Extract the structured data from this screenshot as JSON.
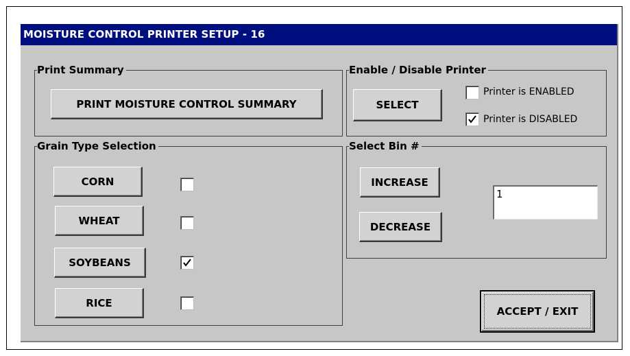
{
  "window": {
    "title": "MOISTURE CONTROL PRINTER SETUP - 16",
    "title_bar_color": "#000f80",
    "background_color": "#c7c7c7"
  },
  "print_summary": {
    "legend": "Print Summary",
    "button_label": "PRINT MOISTURE CONTROL SUMMARY"
  },
  "printer": {
    "legend": "Enable / Disable Printer",
    "select_label": "SELECT",
    "enabled_label": "Printer is ENABLED",
    "enabled_checked": false,
    "disabled_label": "Printer is DISABLED",
    "disabled_checked": true
  },
  "grain": {
    "legend": "Grain Type Selection",
    "items": [
      {
        "label": "CORN",
        "checked": false
      },
      {
        "label": "WHEAT",
        "checked": false
      },
      {
        "label": "SOYBEANS",
        "checked": true
      },
      {
        "label": "RICE",
        "checked": false
      }
    ]
  },
  "bin": {
    "legend": "Select Bin #",
    "increase_label": "INCREASE",
    "decrease_label": "DECREASE",
    "value": "1"
  },
  "accept_exit_label": "ACCEPT / EXIT"
}
